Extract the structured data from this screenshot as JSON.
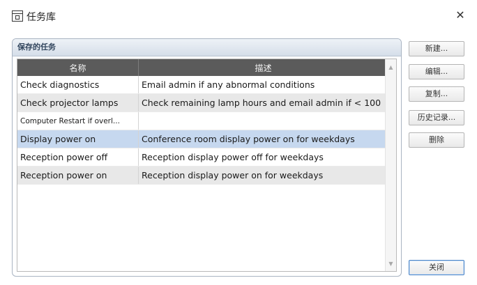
{
  "window": {
    "title": "任务库",
    "close_glyph": "✕"
  },
  "group": {
    "title": "保存的任务"
  },
  "table": {
    "columns": [
      "名称",
      "描述"
    ],
    "rows": [
      {
        "name": "Check diagnostics",
        "description": "Email admin if any abnormal conditions"
      },
      {
        "name": "Check projector lamps",
        "description": "Check remaining lamp hours and email admin if < 100"
      },
      {
        "name": "Computer Restart if overl...",
        "description": ""
      },
      {
        "name": "Display power on",
        "description": "Conference room display power on for weekdays",
        "selected": true
      },
      {
        "name": "Reception power off",
        "description": "Reception display power off for weekdays"
      },
      {
        "name": "Reception power on",
        "description": "Reception display power on for weekdays"
      }
    ]
  },
  "buttons": {
    "new": "新建...",
    "edit": "编辑...",
    "copy": "复制...",
    "history": "历史记录...",
    "delete": "删除",
    "close": "关闭"
  },
  "icons": {
    "app": "task-library-icon",
    "close": "close-icon",
    "scroll_up": "scroll-up-arrow-icon",
    "scroll_down": "scroll-down-arrow-icon"
  },
  "colors": {
    "header_bg": "#5b5b5b",
    "selected_row": "#c6d8ef",
    "alt_row": "#e8e8e8",
    "default_button_border": "#4a84c8"
  }
}
